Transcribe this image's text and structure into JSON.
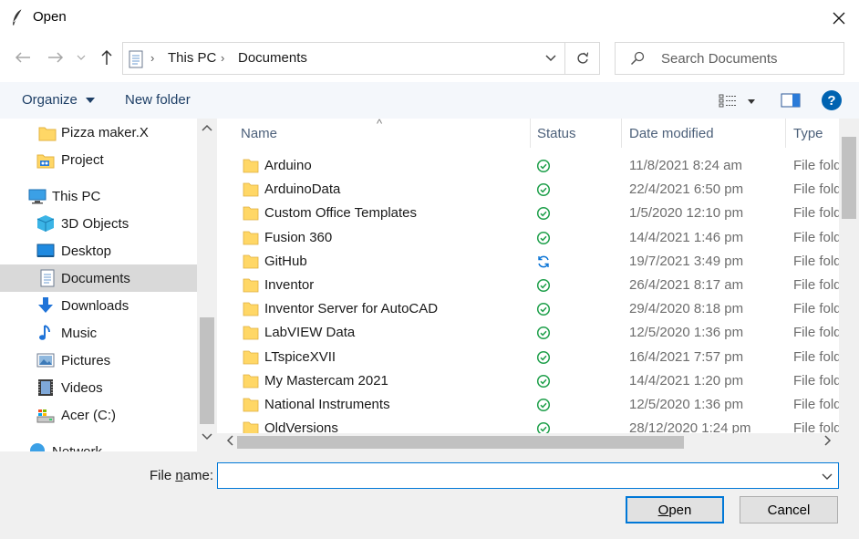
{
  "window": {
    "title": "Open",
    "close_glyph": "✕"
  },
  "nav": {
    "back_glyph": "←",
    "forward_glyph": "→",
    "recent_glyph": "⌄",
    "up_glyph": "↑",
    "breadcrumb": [
      "This PC",
      "Documents"
    ],
    "breadcrumb_sep": "›",
    "search_placeholder": "Search Documents"
  },
  "toolbar": {
    "organize": "Organize",
    "new_folder": "New folder",
    "help": "?"
  },
  "sidebar": {
    "items": [
      {
        "label": "Pizza maker.X",
        "icon": "folder-icon"
      },
      {
        "label": "Project",
        "icon": "project-icon"
      },
      {
        "label": "This PC",
        "icon": "computer-icon"
      },
      {
        "label": "3D Objects",
        "icon": "cube-icon"
      },
      {
        "label": "Desktop",
        "icon": "desktop-icon"
      },
      {
        "label": "Documents",
        "icon": "document-icon",
        "selected": true
      },
      {
        "label": "Downloads",
        "icon": "download-icon"
      },
      {
        "label": "Music",
        "icon": "music-icon"
      },
      {
        "label": "Pictures",
        "icon": "pictures-icon"
      },
      {
        "label": "Videos",
        "icon": "video-icon"
      },
      {
        "label": "Acer (C:)",
        "icon": "drive-icon"
      },
      {
        "label": "Network",
        "icon": "network-icon"
      }
    ]
  },
  "columns": {
    "name": "Name",
    "status": "Status",
    "date": "Date modified",
    "type": "Type"
  },
  "files": [
    {
      "name": "Arduino",
      "status": "synced",
      "date": "11/8/2021 8:24 am",
      "type": "File folder"
    },
    {
      "name": "ArduinoData",
      "status": "synced",
      "date": "22/4/2021 6:50 pm",
      "type": "File folder"
    },
    {
      "name": "Custom Office Templates",
      "status": "synced",
      "date": "1/5/2020 12:10 pm",
      "type": "File folder"
    },
    {
      "name": "Fusion 360",
      "status": "synced",
      "date": "14/4/2021 1:46 pm",
      "type": "File folder"
    },
    {
      "name": "GitHub",
      "status": "syncing",
      "date": "19/7/2021 3:49 pm",
      "type": "File folder"
    },
    {
      "name": "Inventor",
      "status": "synced",
      "date": "26/4/2021 8:17 am",
      "type": "File folder"
    },
    {
      "name": "Inventor Server for AutoCAD",
      "status": "synced",
      "date": "29/4/2020 8:18 pm",
      "type": "File folder"
    },
    {
      "name": "LabVIEW Data",
      "status": "synced",
      "date": "12/5/2020 1:36 pm",
      "type": "File folder"
    },
    {
      "name": "LTspiceXVII",
      "status": "synced",
      "date": "16/4/2021 7:57 pm",
      "type": "File folder"
    },
    {
      "name": "My Mastercam 2021",
      "status": "synced",
      "date": "14/4/2021 1:20 pm",
      "type": "File folder"
    },
    {
      "name": "National Instruments",
      "status": "synced",
      "date": "12/5/2020 1:36 pm",
      "type": "File folder"
    },
    {
      "name": "OldVersions",
      "status": "synced",
      "date": "28/12/2020 1:24 pm",
      "type": "File folder"
    }
  ],
  "footer": {
    "file_name_label": "File name:",
    "file_name_value": "",
    "open": "Open",
    "cancel": "Cancel"
  },
  "colors": {
    "accent": "#0078d7",
    "folder": "#ffd766",
    "synced": "#1e9f4a",
    "syncing": "#0a74d6",
    "help": "#0063b1"
  }
}
